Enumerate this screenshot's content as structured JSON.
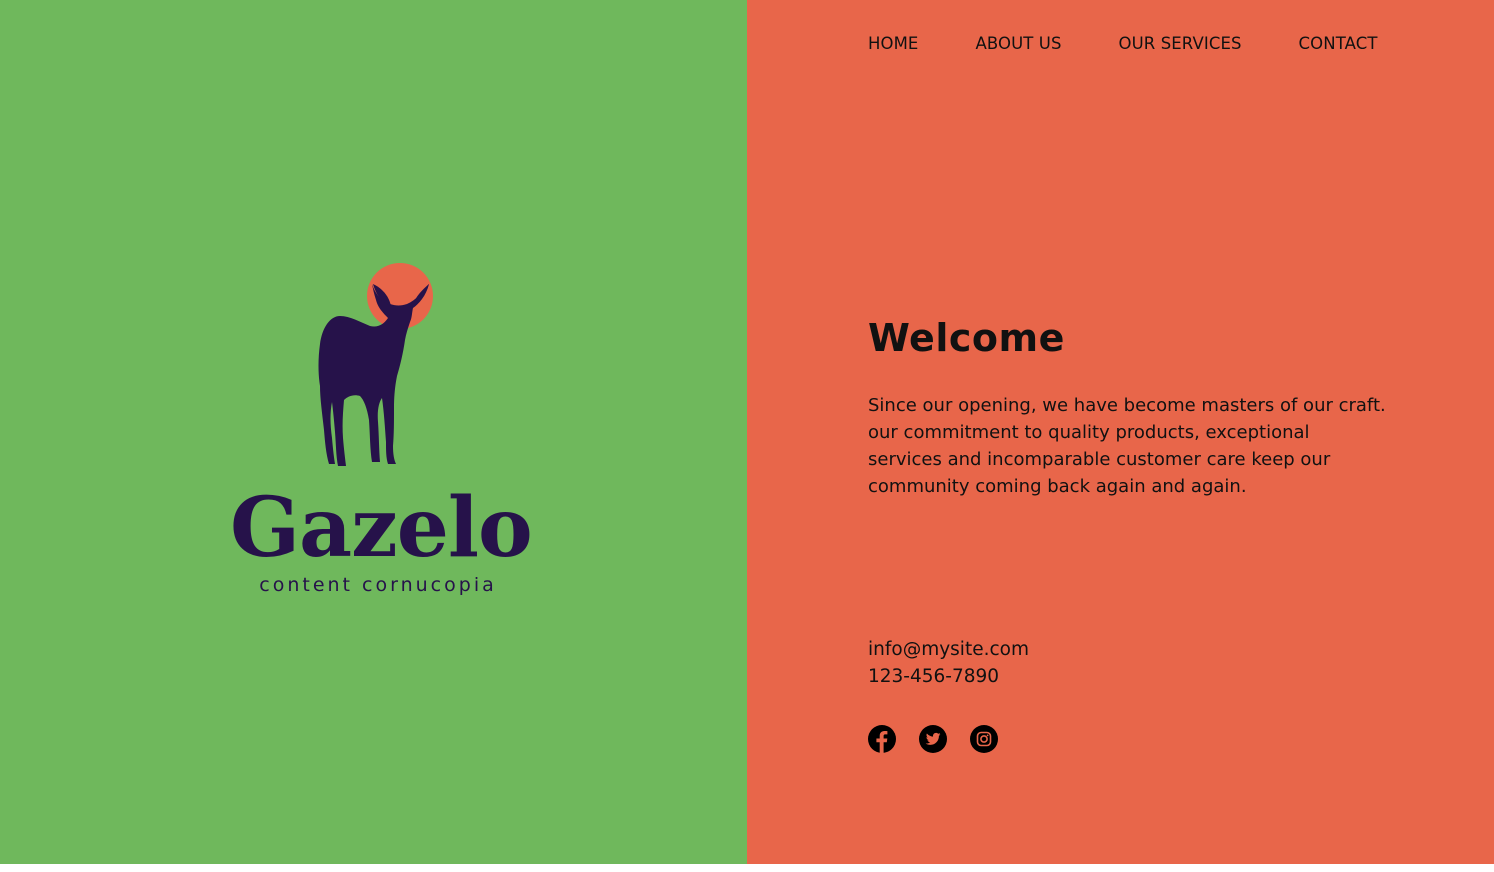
{
  "nav": {
    "home": "HOME",
    "about": "ABOUT US",
    "services": "OUR SERVICES",
    "contact": "CONTACT"
  },
  "brand": {
    "name": "Gazelo",
    "tagline": "content cornucopia"
  },
  "main": {
    "title": "Welcome",
    "body": "Since our opening, we have become masters of our craft. our commitment to quality products, exceptional services and incomparable customer care keep our community coming back again and again."
  },
  "contact": {
    "email": "info@mysite.com",
    "phone": "123-456-7890"
  },
  "social": [
    {
      "icon": "facebook-icon"
    },
    {
      "icon": "twitter-icon"
    },
    {
      "icon": "instagram-icon"
    }
  ],
  "colors": {
    "left_bg": "#6fb85c",
    "right_bg": "#e8664a",
    "logo_dark": "#26124a",
    "sun": "#e8664a"
  }
}
